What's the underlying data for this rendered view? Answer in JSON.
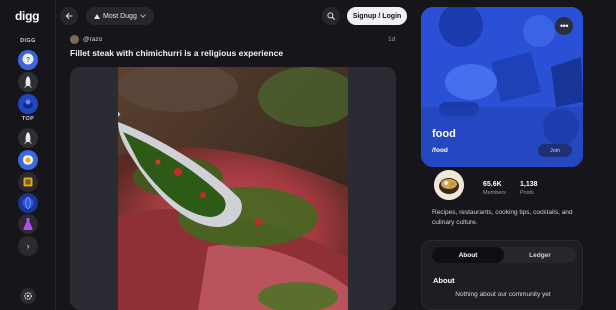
{
  "app": {
    "logo": "digg"
  },
  "rail": {
    "section_digg": "DIGG",
    "section_top": "TOP",
    "more_icon": "chevron-right-icon",
    "settings_icon": "gear-icon"
  },
  "topbar": {
    "sort_label": "Most Dugg",
    "login_label": "Signup / Login"
  },
  "post": {
    "author": "@razo",
    "time": "1d",
    "title": "Fillet steak with chimichurri is a religious experience"
  },
  "community": {
    "name": "food",
    "slug": "/food",
    "join_label": "Join",
    "members_value": "65.6K",
    "members_label": "Members",
    "posts_value": "1,138",
    "posts_label": "Posts",
    "description": "Recipes, restaurants, cooking tips, cocktails, and culinary culture.",
    "tabs": [
      {
        "label": "About",
        "active": true
      },
      {
        "label": "Ledger",
        "active": false
      }
    ],
    "about_heading": "About",
    "about_text": "Nothing about our community yet"
  },
  "colors": {
    "background": "#16161a",
    "card_blue": "#2b52d8",
    "login_button": "#f1f1f3"
  }
}
